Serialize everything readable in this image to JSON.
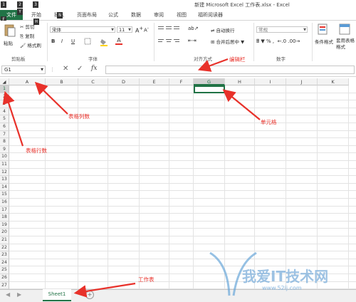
{
  "window": {
    "title": "新建 Microsoft Excel 工作表.xlsx - Excel",
    "keytips": [
      "1",
      "2",
      "3",
      "Y",
      "F",
      "H",
      "N"
    ]
  },
  "tabs": [
    "文件",
    "开始",
    "插入",
    "页面布局",
    "公式",
    "数据",
    "审阅",
    "视图",
    "福昕阅读器"
  ],
  "ribbon": {
    "clipboard": {
      "paste": "粘贴",
      "cut": "剪切",
      "copy": "复制",
      "format_painter": "格式刷",
      "label": "剪贴板"
    },
    "font": {
      "name": "宋体",
      "size": "11",
      "grow": "A",
      "shrink": "A",
      "bold": "B",
      "italic": "I",
      "underline": "U",
      "label": "字体"
    },
    "alignment": {
      "wrap": "自动换行",
      "merge": "合并后居中",
      "label": "对齐方式"
    },
    "number": {
      "format": "常规",
      "label": "数字"
    },
    "styles": {
      "cond": "条件格式",
      "table": "套用表格格式"
    }
  },
  "formula_bar": {
    "name_box": "G1",
    "fx": "fx",
    "value": ""
  },
  "grid": {
    "columns": [
      "A",
      "B",
      "C",
      "D",
      "E",
      "F",
      "G",
      "H",
      "I",
      "J",
      "K"
    ],
    "rows": [
      "1",
      "2",
      "3",
      "4",
      "5",
      "6",
      "7",
      "8",
      "9",
      "10",
      "11",
      "12",
      "13",
      "14",
      "15",
      "16",
      "17",
      "18",
      "19",
      "20",
      "21",
      "22",
      "23",
      "24",
      "25",
      "26",
      "27"
    ],
    "selected_cell": "G1"
  },
  "sheets": {
    "active": "Sheet1",
    "add": "+"
  },
  "annotations": {
    "formula_bar": "编辑栏",
    "col_count": "表格列数",
    "row_count": "表格行数",
    "cell": "单元格",
    "sheet": "工作表"
  },
  "watermark": {
    "text": "我爱IT技术网",
    "url": "www.52ij.com"
  },
  "colors": {
    "excel_green": "#217346",
    "annotation_red": "#e8312a"
  }
}
